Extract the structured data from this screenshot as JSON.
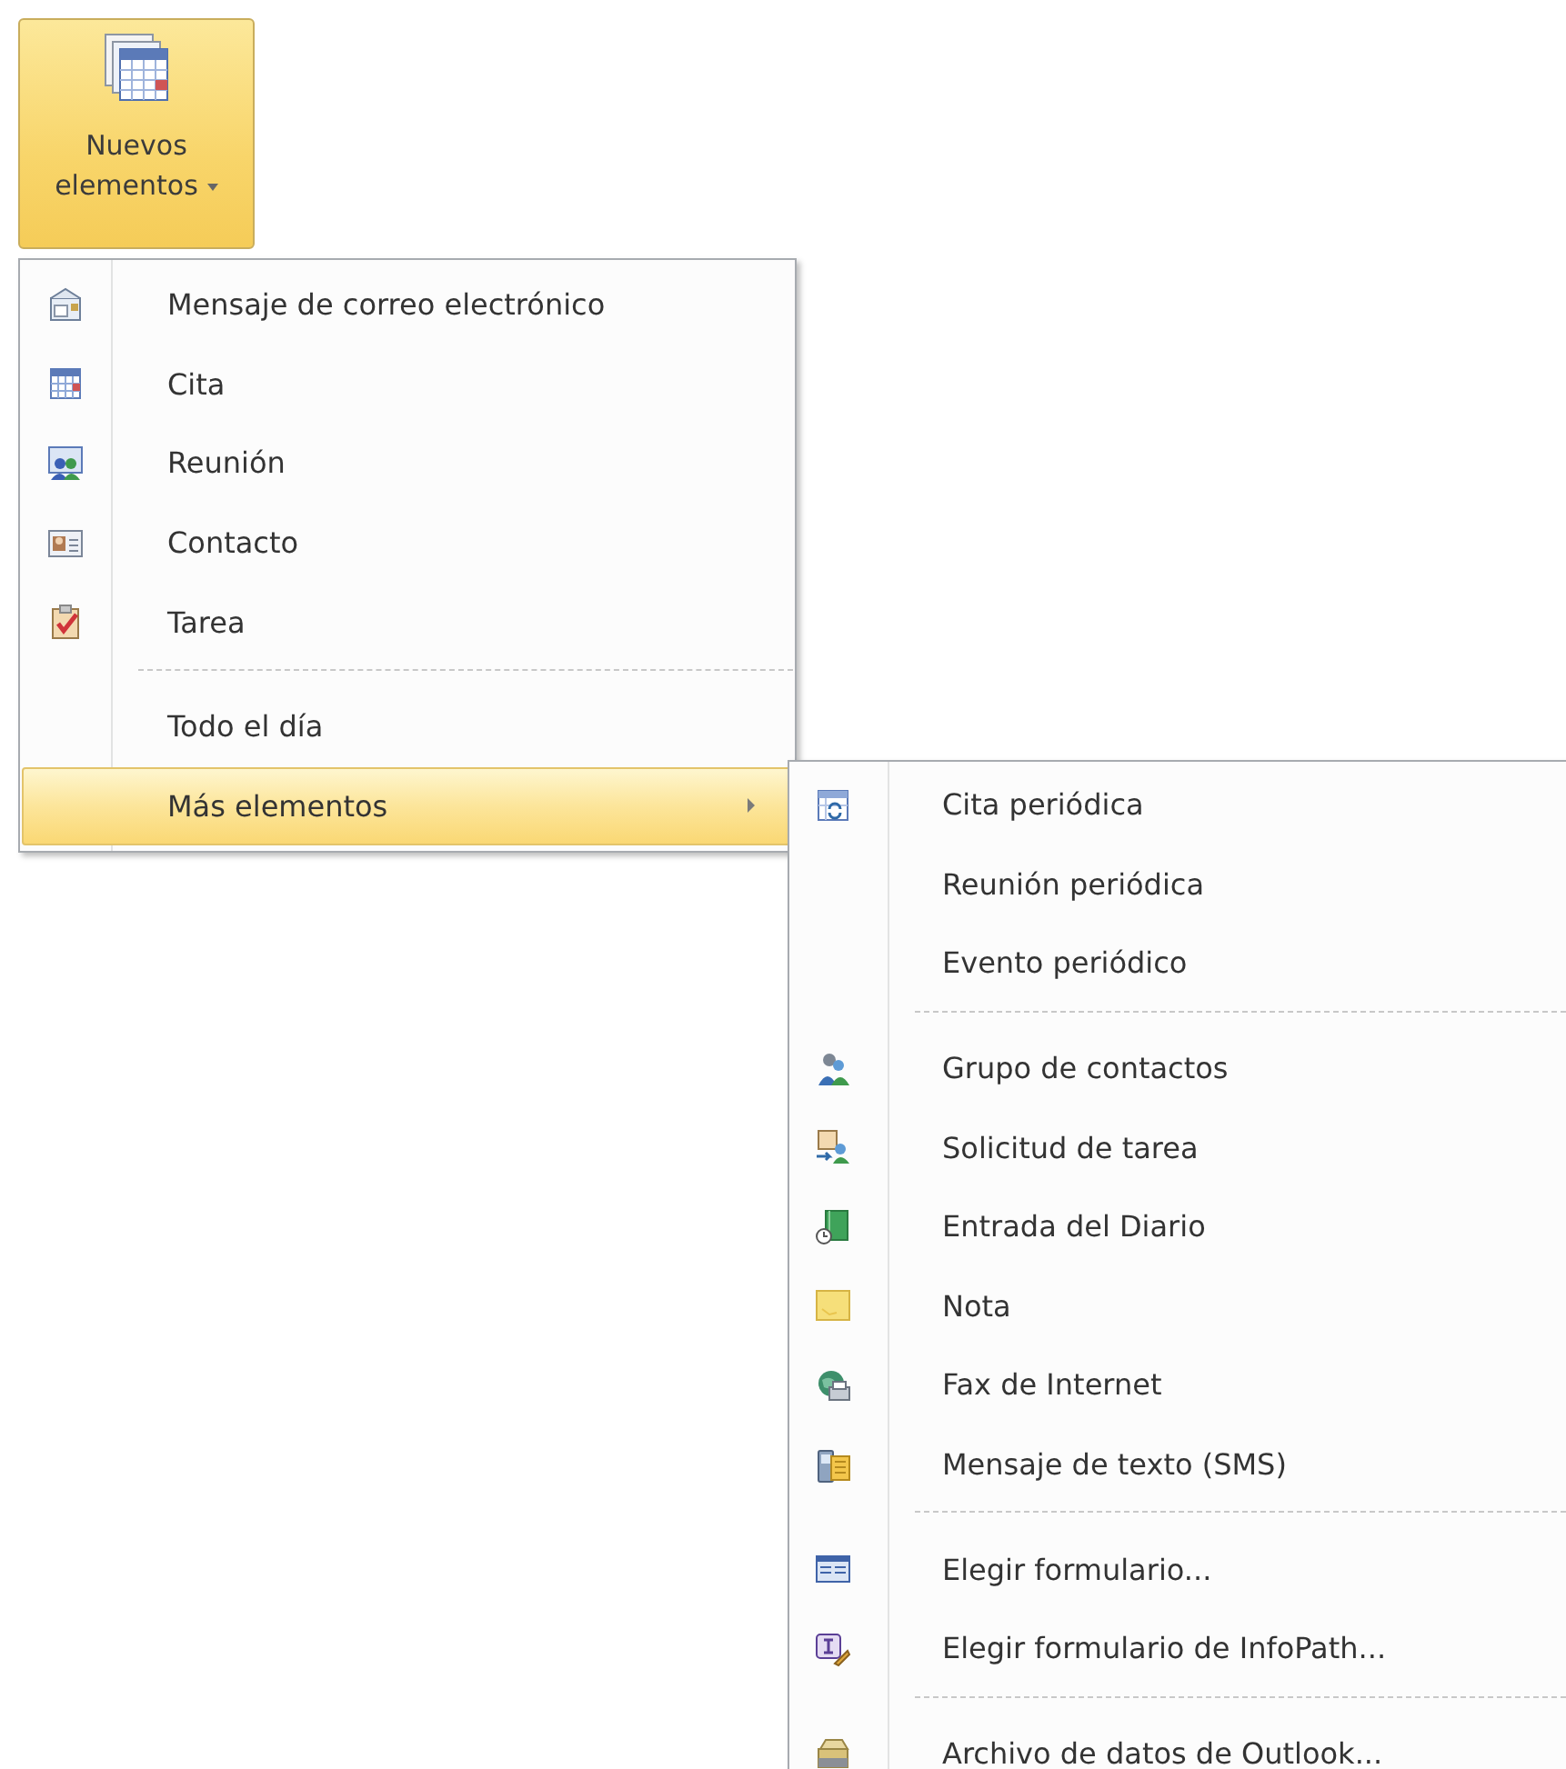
{
  "ribbon_button": {
    "label": "Nuevos elementos",
    "pressed": true
  },
  "menu": {
    "items": [
      {
        "kind": "item",
        "label": "Mensaje de correo electrónico",
        "selected": false
      },
      {
        "kind": "item",
        "label": "Cita",
        "selected": false
      },
      {
        "kind": "item",
        "label": "Reunión",
        "selected": false
      },
      {
        "kind": "item",
        "label": "Contacto",
        "selected": false
      },
      {
        "kind": "item",
        "label": "Tarea",
        "selected": false
      },
      {
        "kind": "separator"
      },
      {
        "kind": "item",
        "label": "Todo el día",
        "selected": false
      },
      {
        "kind": "submenu",
        "label": "Más elementos",
        "selected": true
      }
    ]
  },
  "submenu": {
    "items": [
      {
        "kind": "item",
        "label": "Cita periódica",
        "selected": false
      },
      {
        "kind": "item",
        "label": "Reunión periódica",
        "selected": false
      },
      {
        "kind": "item",
        "label": "Evento periódico",
        "selected": false
      },
      {
        "kind": "separator"
      },
      {
        "kind": "item",
        "label": "Grupo de contactos",
        "selected": false
      },
      {
        "kind": "item",
        "label": "Solicitud de tarea",
        "selected": false
      },
      {
        "kind": "item",
        "label": "Entrada del Diario",
        "selected": false
      },
      {
        "kind": "item",
        "label": "Nota",
        "selected": false
      },
      {
        "kind": "item",
        "label": "Fax de Internet",
        "selected": false
      },
      {
        "kind": "item",
        "label": "Mensaje de texto (SMS)",
        "selected": false
      },
      {
        "kind": "separator"
      },
      {
        "kind": "item",
        "label": "Elegir formulario...",
        "selected": false
      },
      {
        "kind": "item",
        "label": "Elegir formulario de InfoPath...",
        "selected": false
      },
      {
        "kind": "separator"
      },
      {
        "kind": "item",
        "label": "Archivo de datos de Outlook...",
        "selected": false
      }
    ]
  }
}
